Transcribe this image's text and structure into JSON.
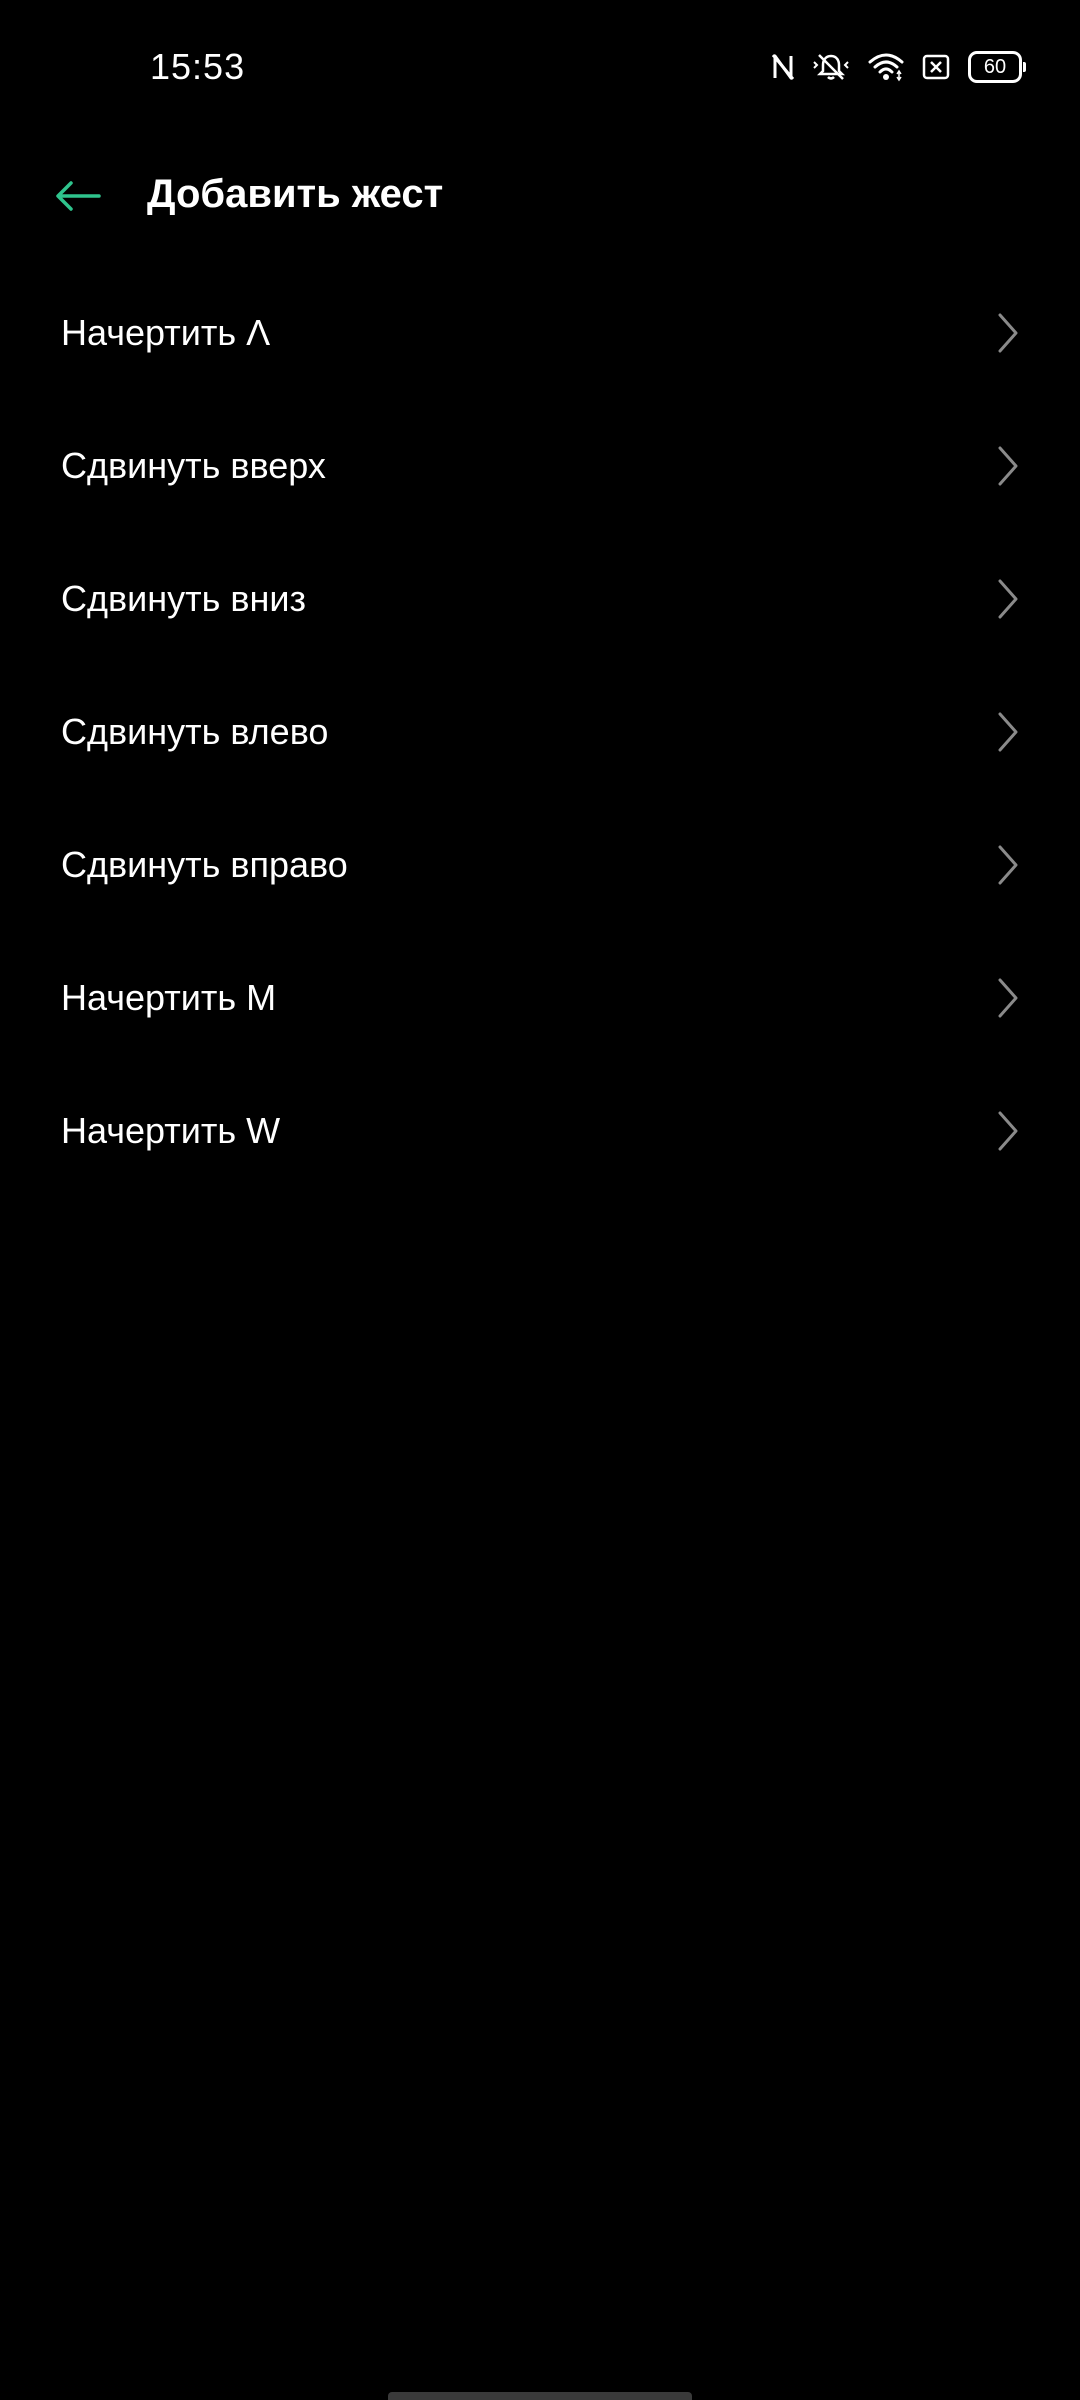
{
  "status_bar": {
    "time": "15:53",
    "battery": "60",
    "icons": [
      "nfc-icon",
      "silent-bell-icon",
      "wifi-icon",
      "sim-icon",
      "battery-icon"
    ]
  },
  "header": {
    "title": "Добавить жест",
    "back_icon": "arrow-left-icon"
  },
  "colors": {
    "accent": "#2fc48d",
    "background": "#000000",
    "text": "#ffffff",
    "chevron": "#8a8a8a"
  },
  "gestures": [
    {
      "label": "Начертить Λ"
    },
    {
      "label": "Сдвинуть вверх"
    },
    {
      "label": "Сдвинуть вниз"
    },
    {
      "label": "Сдвинуть влево"
    },
    {
      "label": "Сдвинуть вправо"
    },
    {
      "label": "Начертить M"
    },
    {
      "label": "Начертить W"
    }
  ]
}
